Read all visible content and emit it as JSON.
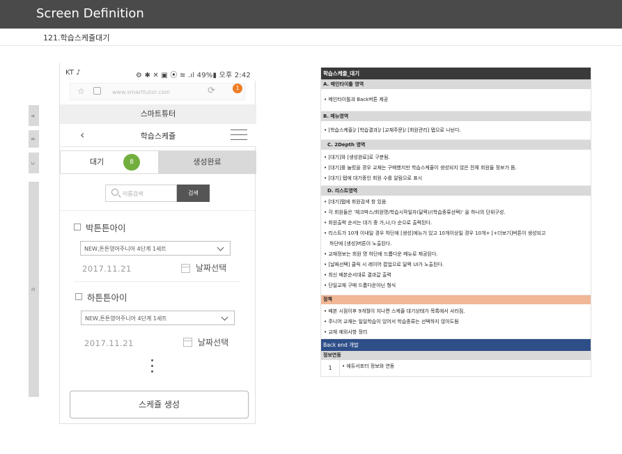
{
  "header": {
    "title": "Screen Definition",
    "subtitle": "121.학습스케쥴대기"
  },
  "side_tags": [
    "A",
    "B",
    "C",
    "D"
  ],
  "phone": {
    "status_left": "KT ♪",
    "status_right": "⚙ ✱ ✕ ▣ ⦿ ≋ .ıl 49%▮ 오후 2:42",
    "url": "www.smarttutor.com",
    "notification_count": "1",
    "brand": "스마트튜터",
    "nav_title": "학습스케쥴",
    "back_icon": "‹",
    "tabs": [
      {
        "label": "대기",
        "badge": "8"
      },
      {
        "label": "생성완료"
      }
    ],
    "search": {
      "placeholder": "이름검색",
      "button": "검색"
    },
    "students": [
      {
        "name": "박튼튼아이",
        "course": "NEW,튼튼영어주니어 4단계 1세트",
        "date": "2017.11.21",
        "date_select": "날짜선택"
      },
      {
        "name": "하튼튼아이",
        "course": "NEW,튼튼영어주니어 4단계 1세트",
        "date": "2017.11.21",
        "date_select": "날짜선택"
      }
    ],
    "create_button": "스케쥴 생성"
  },
  "spec": {
    "title": "학습스케줄_대기",
    "sections": [
      {
        "heading": "A. 메인타이틀 영역",
        "items": [
          "• 메인타이틀과 Back버튼 제공"
        ]
      },
      {
        "heading": "B. 메뉴영역",
        "items": [
          "• [학습스케줄]/ [학습결과]/ [교재주문]/ [회원관리] 탭으로 나뉜다."
        ]
      },
      {
        "heading": "C. 2Depth 영역",
        "items": [
          "• [대기]와 [생성완료]로 구분됨.",
          "• [대기]를 눌렀을 경우 교재는 구매했지만 학습스케쥴이 생성되지 않은 전체 회원들 정보가 뜸.",
          "• [대기] 탭에 대기중인 회원 수를 알림으로 표시"
        ]
      },
      {
        "heading": "D. 리스트영역",
        "items": [
          "• [대기]탭에 회원검색 창 있음",
          "• 각 회원들은 '체크박스/회원명/학습시작일자(달력)/(학습종류선택)' 을 하나의 단위구성.",
          "• 회원출력 순서는 대기 중 가,나,다 순으로 출력된다.",
          "• 리스트가 10개 이내일 경우 하단에 [생성]에뉴가 있고 10개이상일 경우 10개+ [+더보기]버튼이 생성되고",
          "하단에 [생성]버튼이 노출된다.",
          "• 교재정보는 회원 명 하단에 드롭다운 메뉴로 제공된다.",
          "• [날짜선택] 클릭 시 레이어 팝업으로 달력 UI가 노출된다.",
          "• 최신 배본순서대로 결과값 출력",
          "• 단일교재 구매 드롭다운아닌 형식"
        ]
      }
    ],
    "policy": {
      "heading": "정책",
      "items": [
        "• 배본 시점이후 9개월이 지나면  스케쥴 대기상태가 목록에서 사라짐.",
        "• 주니어 교재는 일일학습이 있어서 학습종류는 선택하지 않아도됨",
        "• 교재 예외사항 정리"
      ]
    },
    "backend": {
      "heading": "Back end 개발",
      "info_heading": "정보연동",
      "rows": [
        {
          "num": "1",
          "text": "• 에듀서포터 정보와 연동"
        }
      ]
    }
  }
}
